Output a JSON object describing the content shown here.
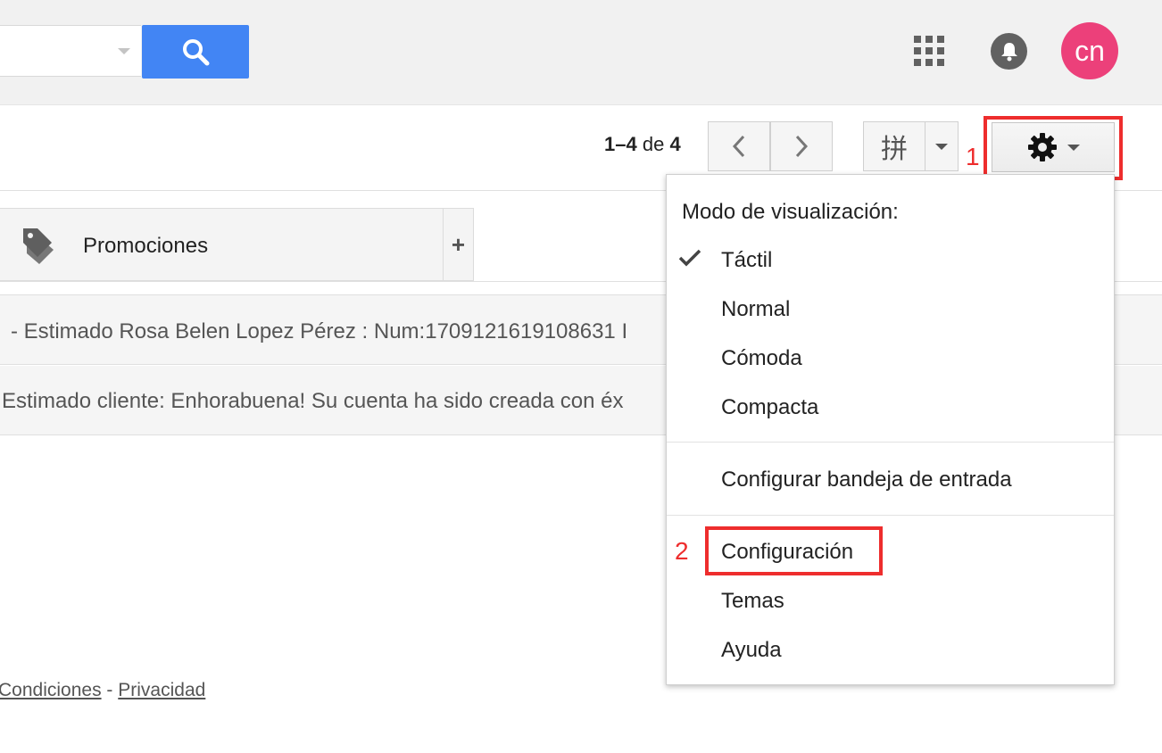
{
  "header": {
    "search": {
      "value": "",
      "placeholder": ""
    },
    "avatar_initials": "cn"
  },
  "toolbar": {
    "pager": {
      "start": "1",
      "dash": "–",
      "end": "4",
      "of": "de",
      "total": "4"
    },
    "density_glyph": "拼",
    "annotation_1": "1",
    "annotation_2": "2"
  },
  "tabs": [
    {
      "label": "Promociones",
      "icon": "tag-icon"
    }
  ],
  "tab_add_label": "+",
  "messages": [
    {
      "snippet": "- Estimado Rosa Belen Lopez Pérez : Num:1709121619108631 I"
    },
    {
      "snippet": "Estimado cliente: Enhorabuena! Su cuenta ha sido creada con éx"
    }
  ],
  "footer": {
    "links": [
      "Condiciones",
      "Privacidad"
    ],
    "separator": "-"
  },
  "settings_menu": {
    "heading": "Modo de visualización:",
    "density_options": [
      {
        "label": "Táctil",
        "checked": true
      },
      {
        "label": "Normal",
        "checked": false
      },
      {
        "label": "Cómoda",
        "checked": false
      },
      {
        "label": "Compacta",
        "checked": false
      }
    ],
    "configure_inbox": "Configurar bandeja de entrada",
    "settings": "Configuración",
    "themes": "Temas",
    "help": "Ayuda"
  },
  "colors": {
    "search_button": "#4285f4",
    "avatar": "#ec407a",
    "annotation": "#ee2d2d"
  }
}
